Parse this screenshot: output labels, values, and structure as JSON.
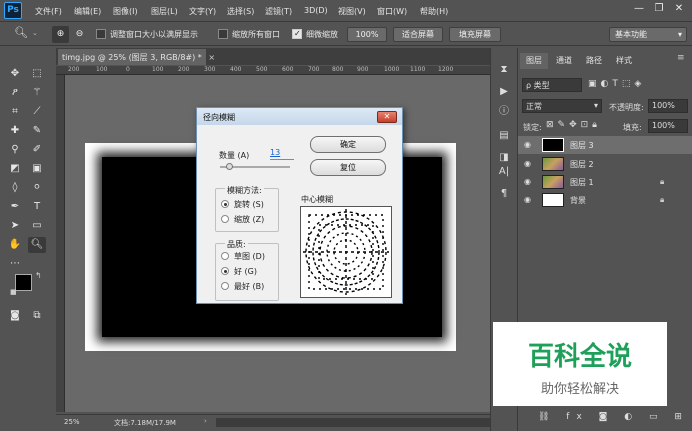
{
  "app": {
    "logo": "Ps"
  },
  "menu": [
    "文件(F)",
    "编辑(E)",
    "图像(I)",
    "图层(L)",
    "文字(Y)",
    "选择(S)",
    "滤镜(T)",
    "3D(D)",
    "视图(V)",
    "窗口(W)",
    "帮助(H)"
  ],
  "window_controls": {
    "minimize": "—",
    "maximize": "❐",
    "close": "✕"
  },
  "options_bar": {
    "resize_window_label": "调整窗口大小以满屏显示",
    "zoom_all_label": "缩放所有窗口",
    "scrubby_zoom_label": "细微缩放",
    "zoom_value": "100%",
    "fit_screen": "适合屏幕",
    "fill_screen": "填充屏幕",
    "workspace": "基本功能",
    "scrubby_zoom_checked": true
  },
  "document": {
    "tab_title": "timg.jpg @ 25% (图层 3, RGB/8#) *",
    "tab_close": "×",
    "ruler_marks": [
      "200",
      "100",
      "0",
      "100",
      "200",
      "300",
      "400",
      "500",
      "600",
      "700",
      "800",
      "900",
      "1000",
      "1100",
      "1200"
    ],
    "zoom": "25%",
    "doc_info": "文档:7.18M/17.9M"
  },
  "dialog": {
    "title": "径向模糊",
    "close": "✕",
    "amount_label": "数量 (A)",
    "amount_value": "13",
    "amount_fraction": 0.13,
    "ok": "确定",
    "reset": "复位",
    "method_label": "模糊方法:",
    "method_spin": "旋转 (S)",
    "method_zoom": "缩放 (Z)",
    "quality_label": "品质:",
    "quality_draft": "草图 (D)",
    "quality_good": "好 (G)",
    "quality_best": "最好 (B)",
    "center_label": "中心模糊"
  },
  "layers_panel": {
    "tabs": [
      "图层",
      "通道",
      "路径",
      "样式"
    ],
    "filter_kind": "ρ 类型",
    "blend_mode": "正常",
    "opacity_label": "不透明度:",
    "opacity_value": "100%",
    "lock_label": "锁定:",
    "fill_label": "填充:",
    "fill_value": "100%",
    "layers": [
      {
        "name": "图层 3",
        "selected": true,
        "locked": false
      },
      {
        "name": "图层 2",
        "selected": false,
        "locked": false
      },
      {
        "name": "图层 1",
        "selected": false,
        "locked": true
      },
      {
        "name": "背景",
        "selected": false,
        "locked": true
      }
    ]
  },
  "watermark": {
    "big": "百科全说",
    "small": "助你轻松解决"
  },
  "colors": {
    "foreground": "#000000",
    "background": "#ffffff",
    "wm_green": "#1ea05a"
  }
}
